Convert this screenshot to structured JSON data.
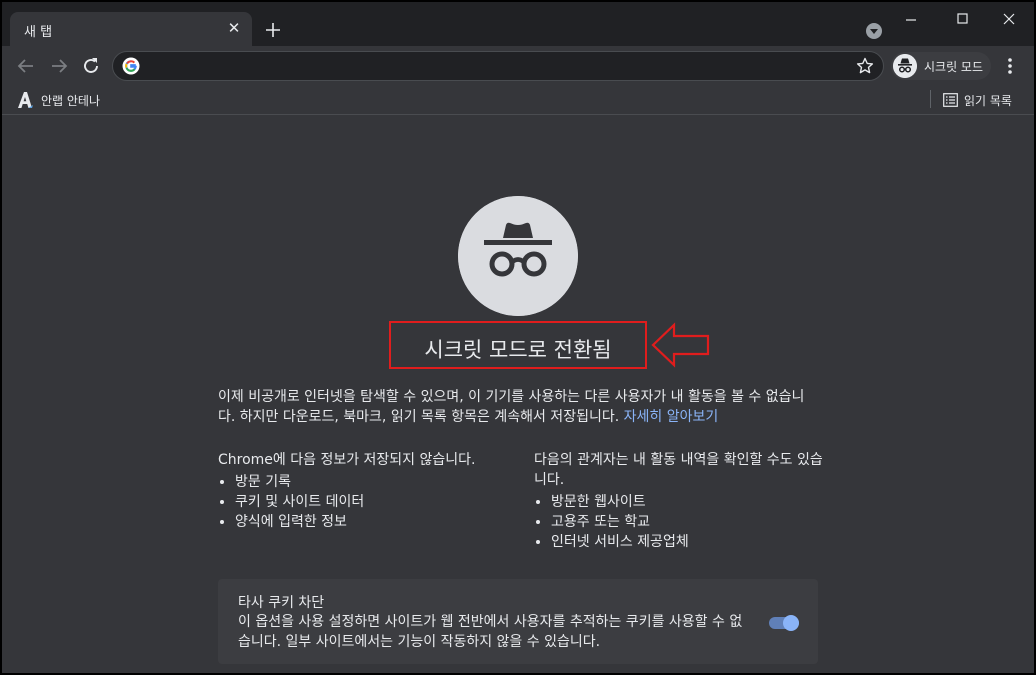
{
  "tab": {
    "title": "새 탭",
    "close_symbol": "✕"
  },
  "toolbar": {
    "address_value": "",
    "incognito_label": "시크릿 모드"
  },
  "bookmarks": {
    "items": [
      {
        "label": "안랩 안테나",
        "icon": "ahnlab-a-icon"
      }
    ],
    "reading_list_label": "읽기 목록"
  },
  "page": {
    "headline": "시크릿 모드로 전환됨",
    "intro_text": "이제 비공개로 인터넷을 탐색할 수 있으며, 이 기기를 사용하는 다른 사용자가 내 활동을 볼 수 없습니다. 하지만 다운로드, 북마크, 읽기 목록 항목은 계속해서 저장됩니다.",
    "learn_more": "자세히 알아보기",
    "not_saved": {
      "heading": "Chrome에 다음 정보가 저장되지 않습니다.",
      "items": [
        "방문 기록",
        "쿠키 및 사이트 데이터",
        "양식에 입력한 정보"
      ]
    },
    "visible_to": {
      "heading": "다음의 관계자는 내 활동 내역을 확인할 수도 있습니다.",
      "items": [
        "방문한 웹사이트",
        "고용주 또는 학교",
        "인터넷 서비스 제공업체"
      ]
    },
    "cookie_block": {
      "title": "타사 쿠키 차단",
      "description": "이 옵션을 사용 설정하면 사이트가 웹 전반에서 사용자를 추적하는 쿠키를 사용할 수 없습니다. 일부 사이트에서는 기능이 작동하지 않을 수 있습니다.",
      "enabled": true
    }
  },
  "colors": {
    "frame": "#202124",
    "surface": "#35363a",
    "link": "#8ab4f8",
    "annotation_red": "#e01d1d"
  }
}
